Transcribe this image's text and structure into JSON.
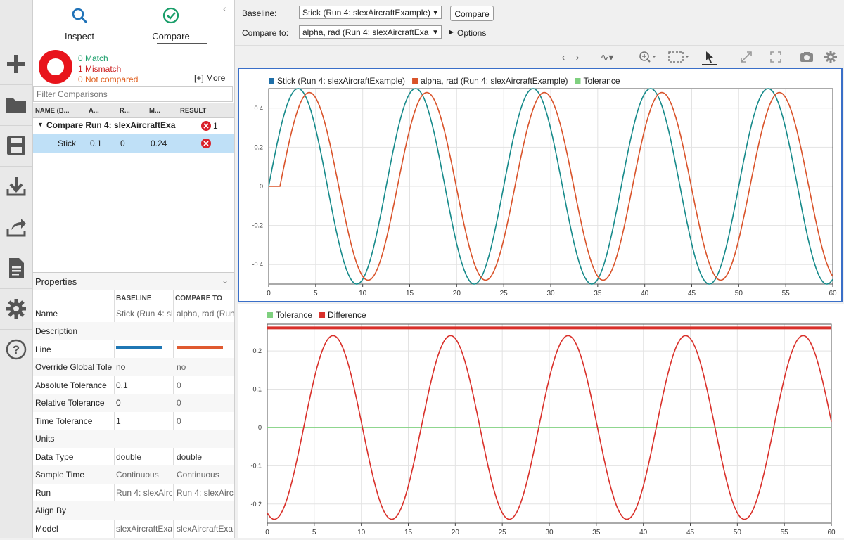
{
  "vtoolbar": {
    "icons": [
      "add-icon",
      "folder-icon",
      "save-icon",
      "download-icon",
      "share-icon",
      "report-icon",
      "settings-icon",
      "help-icon"
    ]
  },
  "tabs": {
    "inspect": "Inspect",
    "compare": "Compare",
    "collapse": "‹"
  },
  "summary": {
    "match": "0 Match",
    "mismatch": "1 Mismatch",
    "not_compared": "0 Not compared",
    "more": "[+] More",
    "colors": {
      "match": "#1a9e6a",
      "mismatch": "#cc2020",
      "not_compared": "#e06020"
    }
  },
  "filter": {
    "placeholder": "Filter Comparisons"
  },
  "table": {
    "headers": [
      "NAME (B...",
      "A...",
      "R...",
      "M...",
      "RESULT"
    ],
    "group": {
      "label": "Compare Run 4: slexAircraftExa",
      "count": "1"
    },
    "row": {
      "name": "Stick",
      "abs": "0.1",
      "rel": "0",
      "max": "0.24"
    }
  },
  "properties": {
    "title": "Properties",
    "col_baseline": "BASELINE",
    "col_compare": "COMPARE TO",
    "rows": [
      {
        "name": "Name",
        "baseline": "Stick (Run 4: sl",
        "compare": "alpha, rad (Run"
      },
      {
        "name": "Description",
        "baseline": "",
        "compare": ""
      },
      {
        "name": "Line",
        "baseline": "",
        "compare": ""
      },
      {
        "name": "Override Global Tole",
        "baseline": "no",
        "compare": "no"
      },
      {
        "name": "Absolute Tolerance",
        "baseline": "0.1",
        "compare": "0"
      },
      {
        "name": "Relative Tolerance",
        "baseline": "0",
        "compare": "0"
      },
      {
        "name": "Time Tolerance",
        "baseline": "1",
        "compare": "0"
      },
      {
        "name": "Units",
        "baseline": "",
        "compare": ""
      },
      {
        "name": "Data Type",
        "baseline": "double",
        "compare": "double"
      },
      {
        "name": "Sample Time",
        "baseline": "Continuous",
        "compare": "Continuous"
      },
      {
        "name": "Run",
        "baseline": "Run 4: slexAirc",
        "compare": "Run 4: slexAirc"
      },
      {
        "name": "Align By",
        "baseline": "",
        "compare": ""
      },
      {
        "name": "Model",
        "baseline": "slexAircraftExa",
        "compare": "slexAircraftExa"
      }
    ],
    "line_colors": {
      "baseline": "#1f77b4",
      "compare": "#e05a30"
    }
  },
  "topbar": {
    "baseline_label": "Baseline:",
    "baseline_value": "Stick (Run 4: slexAircraftExample)",
    "compare_label": "Compare to:",
    "compare_value": "alpha, rad (Run 4: slexAircraftExa",
    "compare_button": "Compare",
    "options": "Options"
  },
  "chart_data": [
    {
      "type": "line",
      "legend": [
        "Stick (Run 4: slexAircraftExample)",
        "alpha, rad (Run 4: slexAircraftExample)",
        "Tolerance"
      ],
      "legend_colors": [
        "#1f6fa8",
        "#d9532a",
        "#7fd07f"
      ],
      "xlim": [
        0,
        60
      ],
      "ylim": [
        -0.5,
        0.5
      ],
      "xticks": [
        0,
        5,
        10,
        15,
        20,
        25,
        30,
        35,
        40,
        45,
        50,
        55,
        60
      ],
      "yticks": [
        0.4,
        0.2,
        0,
        -0.2,
        -0.4
      ],
      "ytick_labels": [
        "0.4",
        "0.2",
        "0",
        "-0.2",
        "-0.4"
      ],
      "series": [
        {
          "name": "Stick (Run 4: slexAircraftExample)",
          "color": "#168a8a",
          "kind": "sine",
          "amplitude": 0.5,
          "period": 12.5,
          "delay": 0
        },
        {
          "name": "alpha, rad (Run 4: slexAircraftExample)",
          "color": "#d9532a",
          "kind": "sine",
          "amplitude": 0.48,
          "period": 12.5,
          "delay": 1.2
        }
      ]
    },
    {
      "type": "line",
      "legend": [
        "Tolerance",
        "Difference"
      ],
      "legend_colors": [
        "#7fd07f",
        "#d9302a"
      ],
      "xlim": [
        0,
        60
      ],
      "ylim": [
        -0.25,
        0.27
      ],
      "xticks": [
        0,
        5,
        10,
        15,
        20,
        25,
        30,
        35,
        40,
        45,
        50,
        55,
        60
      ],
      "yticks": [
        0.2,
        0.1,
        0,
        -0.1,
        -0.2
      ],
      "ytick_labels": [
        "0.2",
        "0.1",
        "0",
        "-0.1",
        "-0.2"
      ],
      "series": [
        {
          "name": "Tolerance",
          "color": "#7fd07f",
          "kind": "constant",
          "value": 0
        },
        {
          "name": "Difference",
          "color": "#d9302a",
          "kind": "sine",
          "amplitude": 0.24,
          "period": 12.5,
          "peak_at": 7.0
        },
        {
          "name": "Difference band",
          "color": "#d9302a",
          "kind": "constant",
          "value": 0.26
        }
      ]
    }
  ]
}
